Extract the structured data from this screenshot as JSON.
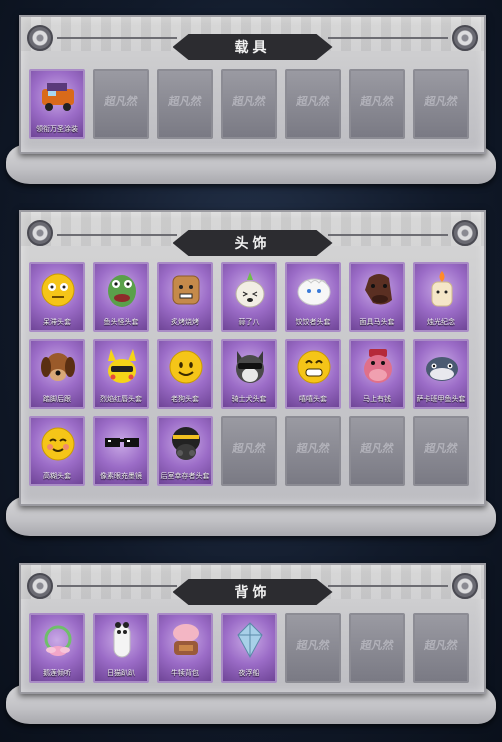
{
  "sections": [
    {
      "title": "载具",
      "items": [
        {
          "name": "领衔万圣涂装",
          "icon": "halloween-vehicle-icon"
        },
        null,
        null,
        null,
        null,
        null,
        null
      ]
    },
    {
      "title": "头饰",
      "items": [
        {
          "name": "呆滞头套",
          "icon": "dazed-emoji-head-icon"
        },
        {
          "name": "鱼头怪头套",
          "icon": "fish-monster-head-icon"
        },
        {
          "name": "炙烤烧烤",
          "icon": "toast-head-icon"
        },
        {
          "name": "蒜了八",
          "icon": "garlic-head-icon"
        },
        {
          "name": "饺饺者头套",
          "icon": "dumpling-head-icon"
        },
        {
          "name": "面具马头套",
          "icon": "horse-head-icon"
        },
        {
          "name": "烛光纪念",
          "icon": "candle-head-icon"
        },
        {
          "name": "踏脚后跟",
          "icon": "sausage-dog-head-icon"
        },
        {
          "name": "烈焰红唇头套",
          "icon": "yellow-creature-head-icon"
        },
        {
          "name": "老狗头套",
          "icon": "smile-emoji-head-icon"
        },
        {
          "name": "骑士犬头套",
          "icon": "husky-head-icon"
        },
        {
          "name": "嘻嘻头套",
          "icon": "grin-emoji-head-icon"
        },
        {
          "name": "马上有钱",
          "icon": "pink-hippo-head-icon"
        },
        {
          "name": "萨卡班甲鱼头套",
          "icon": "armored-fish-head-icon"
        },
        {
          "name": "高糊头套",
          "icon": "blushing-emoji-head-icon"
        },
        {
          "name": "像素眼充墨镜",
          "icon": "pixel-sunglasses-icon"
        },
        {
          "name": "后室幸存者头套",
          "icon": "gas-mask-helmet-icon"
        },
        null,
        null,
        null,
        null
      ]
    },
    {
      "title": "背饰",
      "items": [
        {
          "name": "鹅莲倾听",
          "icon": "lotus-wreath-icon"
        },
        {
          "name": "日猫趴趴",
          "icon": "panda-pillow-icon"
        },
        {
          "name": "牛犊背包",
          "icon": "cow-backpack-icon"
        },
        {
          "name": "夜浮船",
          "icon": "crystal-lantern-icon"
        },
        null,
        null,
        null
      ]
    }
  ],
  "placeholder_logo": "超凡然",
  "colors": {
    "filled_slot": "#9b6cc7",
    "empty_slot": "#7a7a84",
    "banner": "#2c2c30"
  }
}
